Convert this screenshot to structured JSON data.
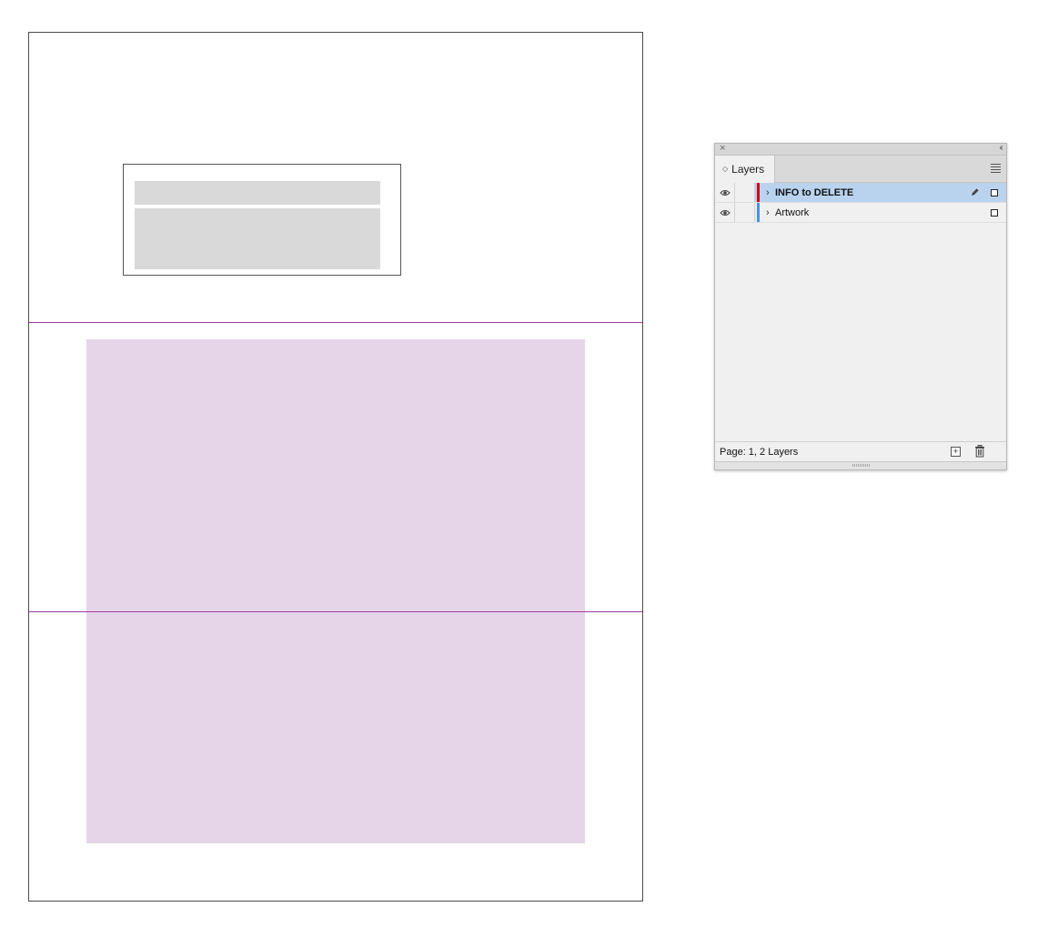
{
  "panel": {
    "close_glyph": "×",
    "collapse_glyph": "‹‹",
    "tab_label": "Layers",
    "tab_sort_glyph": "◇",
    "layers": [
      {
        "name": "INFO to DELETE",
        "color": "#d0021b",
        "selected": true,
        "visible": true,
        "editable_icon": "pen-icon"
      },
      {
        "name": "Artwork",
        "color": "#4a90e2",
        "selected": false,
        "visible": true
      }
    ],
    "status_text": "Page: 1, 2 Layers",
    "new_layer_glyph": "+"
  },
  "colors": {
    "guide": "#9b3d9b",
    "art_fill": "#e6d4e9",
    "placeholder": "#d9d9d9",
    "selection": "#b9d3ef"
  }
}
